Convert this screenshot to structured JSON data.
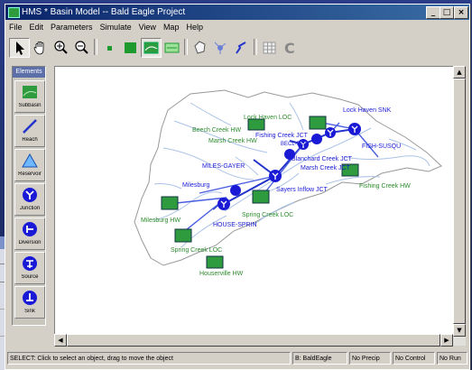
{
  "window": {
    "title": "HMS * Basin Model -- Bald Eagle Project"
  },
  "window_buttons": {
    "minimize": "_",
    "maximize": "□",
    "close": "×"
  },
  "menu": [
    "File",
    "Edit",
    "Parameters",
    "Simulate",
    "View",
    "Map",
    "Help"
  ],
  "toolbar": {
    "tools": [
      "select-tool",
      "pan-tool",
      "zoom-in-tool",
      "zoom-out-tool",
      "small-view",
      "large-view",
      "basin-view",
      "map-view",
      "polygon-tool",
      "junction-tool",
      "reach-tool",
      "grid-tool",
      "compute-tool"
    ]
  },
  "elements_panel": {
    "title": "Elements",
    "tools": [
      {
        "label": "Subbasin"
      },
      {
        "label": "Reach"
      },
      {
        "label": "Reservoir"
      },
      {
        "label": "Junction"
      },
      {
        "label": "Diversion"
      },
      {
        "label": "Source"
      },
      {
        "label": "Sink"
      }
    ]
  },
  "map": {
    "labels": {
      "lock_haven_loc": "Lock Haven LOC",
      "lock_haven_snk": "Lock Haven SNK",
      "beech_creek_hw": "Beech Creek HW",
      "marsh_creek_hw": "Marsh Creek HW",
      "fishing_creek_jct": "Fishing Creek JCT",
      "becl_fish": "BECL-FISH",
      "fish_susqu": "FISH-SUSQU",
      "miles_gayer": "MILES-GAYER",
      "blanchard_creek_jct": "Blanchard Creek JCT",
      "marsh_creek_jct": "Marsh Creek JCT",
      "milesburg": "Milesburg",
      "sayers_inflow_jct": "Sayers Inflow JCT",
      "fishing_creek_hw": "Fishing Creek HW",
      "milesburg_hw": "Milesburg HW",
      "spring_creek_loc": "Spring Creek LOC",
      "house_sprin": "HOUSE-SPRIN",
      "spring_creek_loc2": "Spring Creek LOC",
      "houserville_hw": "Houserville HW"
    }
  },
  "status": {
    "message": "SELECT: Click to select an object, drag to move the object",
    "basin": "B: BaldEagle",
    "precip": "No Precip",
    "control": "No Control",
    "run": "No Run"
  },
  "colors": {
    "title_bar": "#0a246a",
    "junction": "#1a1ad6",
    "reach": "#2233cc",
    "subbasin": "#2e9b3e",
    "river": "#aac3e8"
  }
}
